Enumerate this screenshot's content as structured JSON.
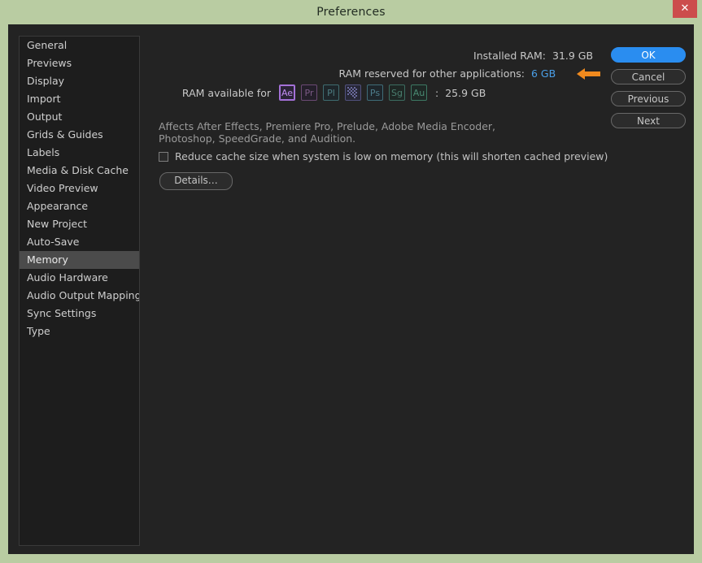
{
  "window": {
    "title": "Preferences",
    "close_label": "✕",
    "titlebar_color": "#b9cca2",
    "close_color": "#cc4c4c",
    "dialog_bg": "#232323"
  },
  "sidebar": {
    "items": [
      {
        "label": "General",
        "selected": false
      },
      {
        "label": "Previews",
        "selected": false
      },
      {
        "label": "Display",
        "selected": false
      },
      {
        "label": "Import",
        "selected": false
      },
      {
        "label": "Output",
        "selected": false
      },
      {
        "label": "Grids & Guides",
        "selected": false
      },
      {
        "label": "Labels",
        "selected": false
      },
      {
        "label": "Media & Disk Cache",
        "selected": false
      },
      {
        "label": "Video Preview",
        "selected": false
      },
      {
        "label": "Appearance",
        "selected": false
      },
      {
        "label": "New Project",
        "selected": false
      },
      {
        "label": "Auto-Save",
        "selected": false
      },
      {
        "label": "Memory",
        "selected": true
      },
      {
        "label": "Audio Hardware",
        "selected": false
      },
      {
        "label": "Audio Output Mapping",
        "selected": false
      },
      {
        "label": "Sync Settings",
        "selected": false
      },
      {
        "label": "Type",
        "selected": false
      }
    ]
  },
  "main": {
    "installed_ram": {
      "label": "Installed RAM:",
      "value": "31.9 GB"
    },
    "reserved_ram": {
      "label": "RAM reserved for other applications:",
      "value": "6 GB",
      "value_color": "#4a9fe8",
      "annotation": "left-arrow",
      "annotation_color": "#f08a1e"
    },
    "available": {
      "label": "RAM available for",
      "separator": ":",
      "total": "25.9 GB",
      "apps": [
        {
          "code": "Ae",
          "name": "after-effects",
          "active": true,
          "text": "#c08cf0",
          "border": "#a471d8",
          "bg": "#2a2336"
        },
        {
          "code": "Pr",
          "name": "premiere-pro",
          "active": false,
          "text": "#7b5a85",
          "border": "#6b4a74",
          "bg": "#241f2a"
        },
        {
          "code": "Pl",
          "name": "prelude",
          "active": false,
          "text": "#4d7d82",
          "border": "#3f6c70",
          "bg": "#1e262a"
        },
        {
          "code": "Me",
          "name": "media-encoder",
          "active": false,
          "text": "#6a6a9c",
          "border": "#51517e",
          "bg": "#272736"
        },
        {
          "code": "Ps",
          "name": "photoshop",
          "active": false,
          "text": "#4d7d8c",
          "border": "#3f6c78",
          "bg": "#1e262b"
        },
        {
          "code": "Sg",
          "name": "speedgrade",
          "active": false,
          "text": "#4a7d6e",
          "border": "#3c6c60",
          "bg": "#1e2724"
        },
        {
          "code": "Au",
          "name": "audition",
          "active": false,
          "text": "#4a8a72",
          "border": "#3d7863",
          "bg": "#1e2825"
        }
      ]
    },
    "description": "Affects After Effects, Premiere Pro, Prelude, Adobe Media Encoder, Photoshop, SpeedGrade, and Audition.",
    "reduce_cache": {
      "label": "Reduce cache size when system is low on memory (this will shorten cached preview)",
      "checked": false
    },
    "details_button": "Details…"
  },
  "buttons": {
    "ok": "OK",
    "cancel": "Cancel",
    "previous": "Previous",
    "next": "Next",
    "ok_color": "#2a8df0"
  }
}
